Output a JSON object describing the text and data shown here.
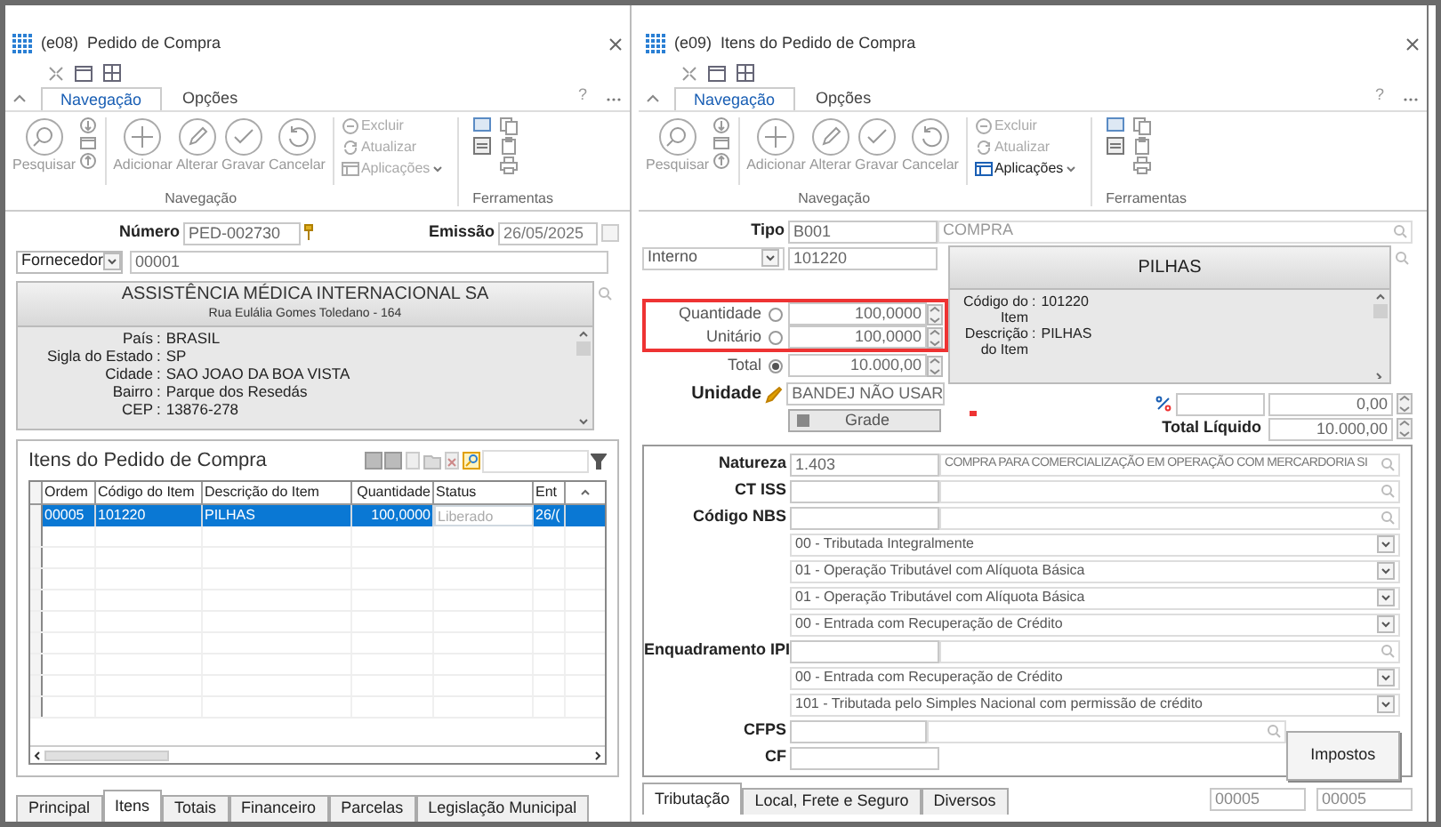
{
  "purchase_order": {
    "title": "(e08)  Pedido de Compra",
    "ribbon": {
      "tabs": [
        {
          "label": "Navegação",
          "selected": true
        },
        {
          "label": "Opções",
          "selected": false
        }
      ],
      "help": "?",
      "large_buttons": [
        {
          "label": "Pesquisar",
          "kind": "search"
        },
        {
          "label": "Adicionar",
          "kind": "add"
        },
        {
          "label": "Alterar",
          "kind": "edit"
        },
        {
          "label": "Gravar",
          "kind": "save"
        },
        {
          "label": "Cancelar",
          "kind": "undo"
        }
      ],
      "small_buttons": [
        {
          "label": "Excluir",
          "kind": "delete",
          "disabled": true
        },
        {
          "label": "Atualizar",
          "kind": "refresh",
          "disabled": true
        },
        {
          "label": "Aplicações",
          "kind": "apps",
          "disabled": true
        }
      ],
      "groups": [
        "Navegação",
        "Ferramentas"
      ]
    },
    "numero": {
      "label": "Número",
      "value": "PED-002730"
    },
    "emissao": {
      "label": "Emissão",
      "value": "26/05/2025"
    },
    "partner": {
      "type": "Fornecedor",
      "code": "00001"
    },
    "supplier_card": {
      "name": "ASSISTÊNCIA MÉDICA INTERNACIONAL SA",
      "address": "Rua Eulália Gomes Toledano - 164",
      "separator": ":",
      "details": [
        {
          "label": "País",
          "value": "BRASIL"
        },
        {
          "label": "Sigla do Estado",
          "value": "SP"
        },
        {
          "label": "Cidade",
          "value": "SAO JOAO DA BOA VISTA"
        },
        {
          "label": "Bairro",
          "value": "Parque dos Resedás"
        },
        {
          "label": "CEP",
          "value": "13876-278"
        }
      ]
    },
    "items": {
      "title": "Itens do Pedido de Compra",
      "columns": [
        "Ordem",
        "Código do Item",
        "Descrição do Item",
        "Quantidade",
        "Status",
        "Ent"
      ],
      "rows": [
        {
          "cells": [
            "00005",
            "101220",
            "PILHAS",
            "100,0000",
            "Liberado",
            "26/("
          ],
          "selected": true
        }
      ]
    },
    "tabs": [
      {
        "label": "Principal",
        "selected": false
      },
      {
        "label": "Itens",
        "selected": true
      },
      {
        "label": "Totais",
        "selected": false
      },
      {
        "label": "Financeiro",
        "selected": false
      },
      {
        "label": "Parcelas",
        "selected": false
      },
      {
        "label": "Legislação Municipal",
        "selected": false
      }
    ]
  },
  "order_item": {
    "title": "(e09)  Itens do Pedido de Compra",
    "ribbon": {
      "tabs": [
        {
          "label": "Navegação",
          "selected": true
        },
        {
          "label": "Opções",
          "selected": false
        }
      ],
      "help": "?",
      "large_buttons": [
        {
          "label": "Pesquisar",
          "kind": "search"
        },
        {
          "label": "Adicionar",
          "kind": "add"
        },
        {
          "label": "Alterar",
          "kind": "edit"
        },
        {
          "label": "Gravar",
          "kind": "save"
        },
        {
          "label": "Cancelar",
          "kind": "undo"
        }
      ],
      "small_buttons": [
        {
          "label": "Excluir",
          "kind": "delete",
          "disabled": true
        },
        {
          "label": "Atualizar",
          "kind": "refresh",
          "disabled": true
        },
        {
          "label": "Aplicações",
          "kind": "apps",
          "disabled": false
        }
      ],
      "groups": [
        "Navegação",
        "Ferramentas"
      ]
    },
    "tipo": {
      "label": "Tipo",
      "code": "B001",
      "description": "COMPRA"
    },
    "item_type": "Interno",
    "item_code": "101220",
    "item_card": {
      "title": "PILHAS",
      "separator": ":",
      "details": [
        {
          "label": "Código do Item",
          "value": "101220"
        },
        {
          "label": "Descrição do Item",
          "value": "PILHAS"
        }
      ]
    },
    "amounts": [
      {
        "label": "Quantidade",
        "value": "100,0000",
        "selected": false,
        "highlighted": true
      },
      {
        "label": "Unitário",
        "value": "100,0000",
        "selected": false,
        "highlighted": true
      },
      {
        "label": "Total",
        "value": "10.000,00",
        "selected": true,
        "highlighted": false
      }
    ],
    "unidade": {
      "label": "Unidade",
      "value": "BANDEJ NÃO USAR"
    },
    "grade_button": "Grade",
    "discount": {
      "value": "0,00"
    },
    "total_liquido": {
      "label": "Total Líquido",
      "value": "10.000,00"
    },
    "fiscal": [
      {
        "kind": "lookup",
        "label": "Natureza",
        "code": "1.403",
        "description": "COMPRA PARA COMERCIALIZAÇÃO EM OPERAÇÃO COM MERCARDORIA SI"
      },
      {
        "kind": "lookup",
        "label": "CT ISS"
      },
      {
        "kind": "lookup",
        "label": "Código NBS"
      },
      {
        "kind": "select",
        "value": "00 - Tributada Integralmente"
      },
      {
        "kind": "select",
        "value": "01 - Operação Tributável com Alíquota Básica"
      },
      {
        "kind": "select",
        "value": "01 - Operação Tributável com Alíquota Básica"
      },
      {
        "kind": "select",
        "value": "00 - Entrada com Recuperação de Crédito"
      },
      {
        "kind": "lookup",
        "label": "Enquadramento IPI"
      },
      {
        "kind": "select",
        "value": "00 - Entrada com Recuperação de Crédito"
      },
      {
        "kind": "select",
        "value": "101 - Tributada pelo Simples Nacional com permissão de crédito"
      },
      {
        "kind": "lookup",
        "label": "CFPS"
      },
      {
        "kind": "code",
        "label": "CF"
      }
    ],
    "impostos_button": "Impostos",
    "tabs": [
      {
        "label": "Tributação",
        "selected": true
      },
      {
        "label": "Local, Frete e Seguro",
        "selected": false
      },
      {
        "label": "Diversos",
        "selected": false
      }
    ],
    "status_fields": [
      "00005",
      "00005"
    ]
  }
}
